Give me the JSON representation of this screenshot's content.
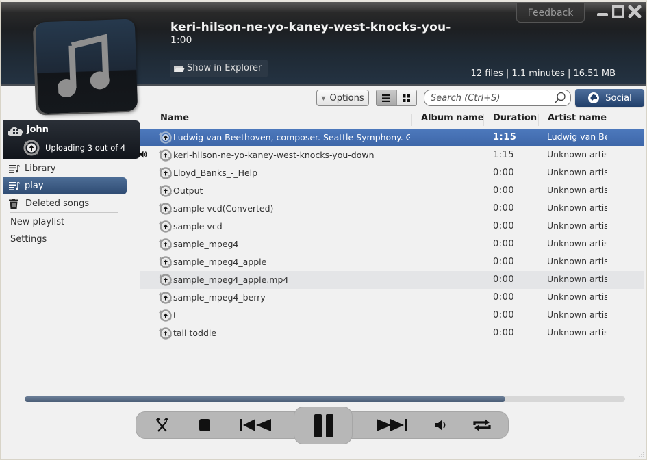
{
  "window": {
    "feedback_label": "Feedback",
    "minimize_icon": "minimize-icon",
    "maximize_icon": "maximize-icon",
    "close_icon": "close-icon"
  },
  "now_playing": {
    "title": "keri-hilson-ne-yo-kaney-west-knocks-you-",
    "time": "1:00",
    "show_in_explorer_label": "Show in Explorer",
    "stats": "12 files | 1.1 minutes | 16.51 MB",
    "art_icon": "music-note-icon"
  },
  "toolbar": {
    "options_label": "Options",
    "view_modes": [
      "list",
      "grid"
    ],
    "active_view": "list",
    "search_placeholder": "Search (Ctrl+S)",
    "search_value": "",
    "social_label": "Social"
  },
  "sidebar": {
    "user": {
      "name": "john",
      "upload_status": "Uploading 3 out of 4"
    },
    "items": [
      {
        "label": "Library",
        "icon": "playlist-icon",
        "active": false
      },
      {
        "label": "play",
        "icon": "playlist-icon",
        "active": true
      },
      {
        "label": "Deleted songs",
        "icon": "trash-icon",
        "active": false
      }
    ],
    "links": [
      {
        "label": "New playlist"
      },
      {
        "label": "Settings"
      }
    ]
  },
  "table": {
    "columns": [
      "Name",
      "Album name",
      "Duration",
      "Artist name"
    ],
    "rows": [
      {
        "name": "Ludwig van Beethoven, composer. Seattle Symphony. Gerard",
        "album": "",
        "duration": "1:15",
        "artist": "Ludwig van Beethoven",
        "state": "selected"
      },
      {
        "name": "keri-hilson-ne-yo-kaney-west-knocks-you-down",
        "album": "",
        "duration": "1:15",
        "artist": "Unknown artist",
        "state": "playing"
      },
      {
        "name": "Lloyd_Banks_-_Help",
        "album": "",
        "duration": "0:00",
        "artist": "Unknown artist",
        "state": ""
      },
      {
        "name": "Output",
        "album": "",
        "duration": "0:00",
        "artist": "Unknown artist",
        "state": ""
      },
      {
        "name": "sample vcd(Converted)",
        "album": "",
        "duration": "0:00",
        "artist": "Unknown artist",
        "state": ""
      },
      {
        "name": "sample vcd",
        "album": "",
        "duration": "0:00",
        "artist": "Unknown artist",
        "state": ""
      },
      {
        "name": "sample_mpeg4",
        "album": "",
        "duration": "0:00",
        "artist": "Unknown artist",
        "state": ""
      },
      {
        "name": "sample_mpeg4_apple",
        "album": "",
        "duration": "0:00",
        "artist": "Unknown artist",
        "state": ""
      },
      {
        "name": "sample_mpeg4_apple.mp4",
        "album": "",
        "duration": "0:00",
        "artist": "Unknown artist",
        "state": "hover"
      },
      {
        "name": "sample_mpeg4_berry",
        "album": "",
        "duration": "0:00",
        "artist": "Unknown artist",
        "state": ""
      },
      {
        "name": "t",
        "album": "",
        "duration": "0:00",
        "artist": "Unknown artist",
        "state": ""
      },
      {
        "name": "tail toddle",
        "album": "",
        "duration": "0:00",
        "artist": "Unknown artist",
        "state": ""
      }
    ]
  },
  "player": {
    "progress_percent": 80,
    "controls": [
      "shuffle-icon",
      "stop-icon",
      "previous-icon",
      "pause-icon",
      "next-icon",
      "volume-icon",
      "repeat-icon"
    ]
  },
  "colors": {
    "accent": "#3d66a8",
    "header_dark": "#1d1f22",
    "social": "#213f6a"
  }
}
